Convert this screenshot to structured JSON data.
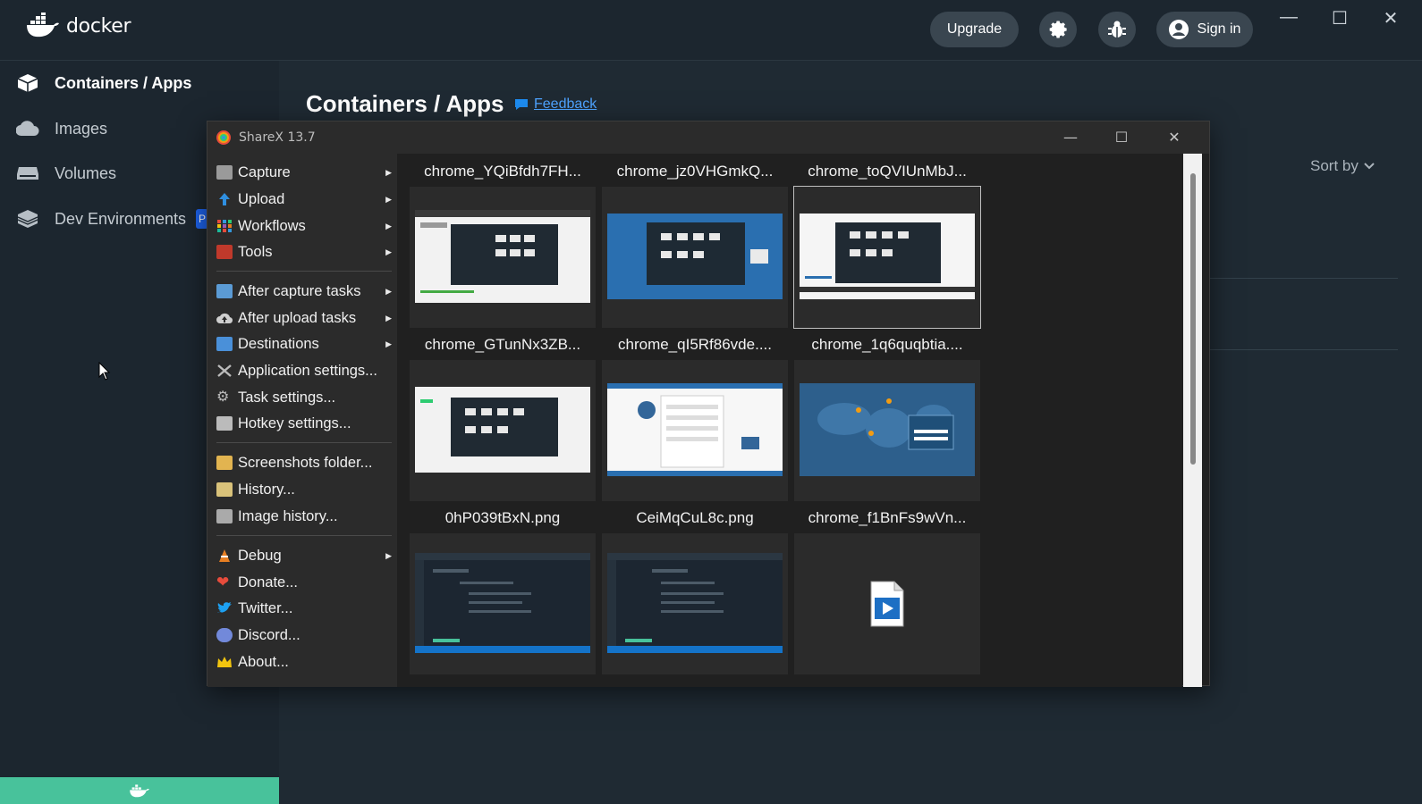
{
  "docker": {
    "brand": "docker",
    "header": {
      "upgrade_label": "Upgrade",
      "signin_label": "Sign in"
    },
    "sidebar": {
      "items": [
        {
          "label": "Containers / Apps",
          "icon": "containers-icon",
          "active": true
        },
        {
          "label": "Images",
          "icon": "cloud-icon"
        },
        {
          "label": "Volumes",
          "icon": "volumes-icon"
        },
        {
          "label": "Dev Environments",
          "icon": "dev-env-icon",
          "badge": "P"
        }
      ]
    },
    "main": {
      "title": "Containers / Apps",
      "feedback_label": "Feedback",
      "sort_label": "Sort by"
    }
  },
  "sharex": {
    "title": "ShareX 13.7",
    "menu": [
      {
        "label": "Capture",
        "submenu": true,
        "icon": "capture-icon",
        "color": "#9a9a9a"
      },
      {
        "label": "Upload",
        "submenu": true,
        "icon": "upload-arrow-icon",
        "color": "#2f8fe0"
      },
      {
        "label": "Workflows",
        "submenu": true,
        "icon": "workflows-grid-icon",
        "color": "#d44"
      },
      {
        "label": "Tools",
        "submenu": true,
        "icon": "toolbox-icon",
        "color": "#c0392b"
      },
      {
        "label": "After capture tasks",
        "submenu": true,
        "icon": "after-capture-icon",
        "color": "#5b9bd5"
      },
      {
        "label": "After upload tasks",
        "submenu": true,
        "icon": "cloud-upload-icon",
        "color": "#bbbbbb"
      },
      {
        "label": "Destinations",
        "submenu": true,
        "icon": "destinations-icon",
        "color": "#4a90d9"
      },
      {
        "label": "Application settings...",
        "submenu": false,
        "icon": "wrench-icon",
        "color": "#aaaaaa"
      },
      {
        "label": "Task settings...",
        "submenu": false,
        "icon": "gear-icon",
        "color": "#bbbbbb"
      },
      {
        "label": "Hotkey settings...",
        "submenu": false,
        "icon": "keyboard-icon",
        "color": "#bbbbbb"
      },
      {
        "label": "Screenshots folder...",
        "submenu": false,
        "icon": "folder-icon",
        "color": "#e2b450"
      },
      {
        "label": "History...",
        "submenu": false,
        "icon": "history-icon",
        "color": "#d9c27a"
      },
      {
        "label": "Image history...",
        "submenu": false,
        "icon": "image-history-icon",
        "color": "#aaaaaa"
      },
      {
        "label": "Debug",
        "submenu": true,
        "icon": "debug-cone-icon",
        "color": "#e67e22"
      },
      {
        "label": "Donate...",
        "submenu": false,
        "icon": "heart-icon",
        "color": "#e74c3c"
      },
      {
        "label": "Twitter...",
        "submenu": false,
        "icon": "twitter-icon",
        "color": "#1da1f2"
      },
      {
        "label": "Discord...",
        "submenu": false,
        "icon": "discord-icon",
        "color": "#7289da"
      },
      {
        "label": "About...",
        "submenu": false,
        "icon": "crown-icon",
        "color": "#f1c40f"
      }
    ],
    "tiles": [
      {
        "name": "chrome_YQiBfdh7FH...",
        "kind": "light-screenshot"
      },
      {
        "name": "chrome_jz0VHGmkQ...",
        "kind": "blue-screenshot"
      },
      {
        "name": "chrome_toQVIUnMbJ...",
        "kind": "light-screenshot",
        "selected": true
      },
      {
        "name": "chrome_GTunNx3ZB...",
        "kind": "light-screenshot"
      },
      {
        "name": "chrome_qI5Rf86vde....",
        "kind": "web-screenshot"
      },
      {
        "name": "chrome_1q6quqbtia....",
        "kind": "map-screenshot"
      },
      {
        "name": "0hP039tBxN.png",
        "kind": "dark-screenshot"
      },
      {
        "name": "CeiMqCuL8c.png",
        "kind": "dark-screenshot"
      },
      {
        "name": "chrome_f1BnFs9wVn...",
        "kind": "video-file"
      }
    ]
  }
}
